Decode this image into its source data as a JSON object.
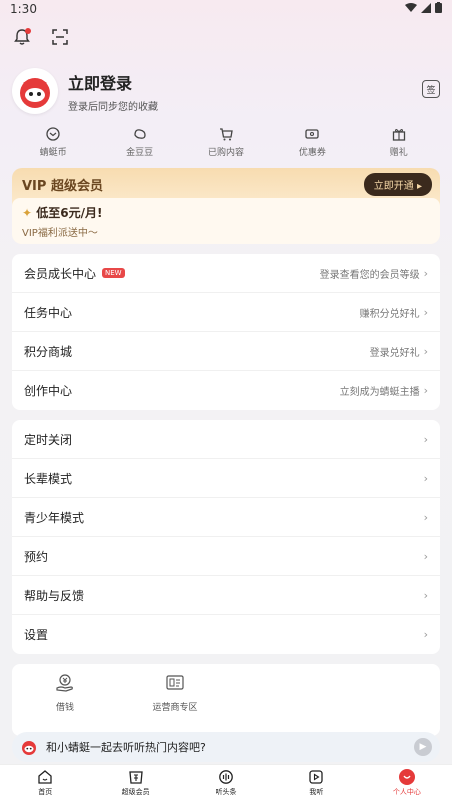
{
  "status_bar": {
    "time": "1:30"
  },
  "profile": {
    "title": "立即登录",
    "subtitle": "登录后同步您的收藏",
    "sign_label": "签"
  },
  "quick_links": [
    {
      "label": "蜻蜓币",
      "icon": "coin-icon"
    },
    {
      "label": "金豆豆",
      "icon": "bean-icon"
    },
    {
      "label": "已购内容",
      "icon": "cart-icon"
    },
    {
      "label": "优惠券",
      "icon": "ticket-icon"
    },
    {
      "label": "赠礼",
      "icon": "gift-icon"
    }
  ],
  "vip": {
    "title": "VIP 超级会员",
    "open_label": "立即开通",
    "promo_line1": "低至6元/月!",
    "promo_line2": "VIP福利派送中～"
  },
  "menu_primary": [
    {
      "label": "会员成长中心",
      "badge": "NEW",
      "right": "登录查看您的会员等级"
    },
    {
      "label": "任务中心",
      "right": "赚积分兑好礼"
    },
    {
      "label": "积分商城",
      "right": "登录兑好礼"
    },
    {
      "label": "创作中心",
      "right": "立刻成为蜻蜓主播"
    }
  ],
  "menu_secondary": [
    {
      "label": "定时关闭"
    },
    {
      "label": "长辈模式"
    },
    {
      "label": "青少年模式"
    },
    {
      "label": "预约"
    },
    {
      "label": "帮助与反馈"
    },
    {
      "label": "设置"
    }
  ],
  "tools": [
    {
      "label": "借钱",
      "icon": "yen-hand-icon"
    },
    {
      "label": "运营商专区",
      "icon": "sim-card-icon"
    }
  ],
  "mini_player": {
    "text": "和小蜻蜓一起去听听热门内容吧?"
  },
  "tabs": [
    {
      "label": "首页",
      "icon": "home-icon"
    },
    {
      "label": "超级会员",
      "icon": "vip-icon"
    },
    {
      "label": "听头条",
      "icon": "headline-icon"
    },
    {
      "label": "我听",
      "icon": "play-box-icon"
    },
    {
      "label": "个人中心",
      "icon": "profile-icon",
      "active": true
    }
  ],
  "colors": {
    "accent": "#e53a3a",
    "vip_dark": "#3b2a1d",
    "vip_gold": "#f7dcb0"
  }
}
